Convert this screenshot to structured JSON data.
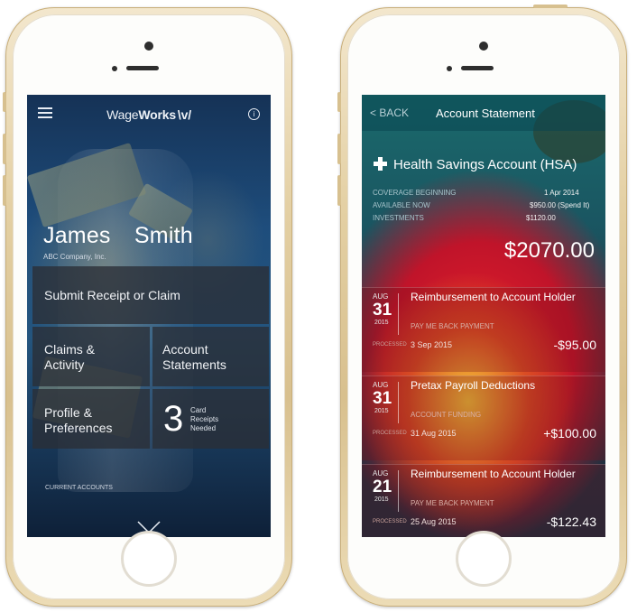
{
  "left_phone": {
    "header": {
      "brand_text": "Wage",
      "brand_bold": "Works",
      "brand_mark": "\\v/",
      "info_icon_glyph": "i"
    },
    "user": {
      "name": "James  Smith",
      "company": "ABC Company, Inc."
    },
    "tiles": {
      "submit": "Submit Receipt or Claim",
      "claims": "Claims &\nActivity",
      "statements": "Account\nStatements",
      "profile": "Profile &\nPreferences",
      "card_count": "3",
      "card_text": "Card\nReceipts\nNeeded"
    },
    "footer": {
      "current_accounts": "CURRENT ACCOUNTS"
    }
  },
  "right_phone": {
    "navbar": {
      "back_label": "< BACK",
      "title": "Account Statement"
    },
    "account": {
      "name": "Health Savings Account (HSA)",
      "coverage_label": "COVERAGE BEGINNING",
      "coverage_value": "1 Apr 2014",
      "available_label": "AVAILABLE NOW",
      "available_value": "$950.00 (Spend It)",
      "investments_label": "INVESTMENTS",
      "investments_value": "$1120.00",
      "balance": "$2070.00"
    },
    "transactions": [
      {
        "month": "AUG",
        "day": "31",
        "year": "2015",
        "description": "Reimbursement to Account Holder",
        "type": "PAY ME BACK PAYMENT",
        "processed_label": "PROCESSED",
        "processed_date": "3 Sep 2015",
        "amount": "-$95.00"
      },
      {
        "month": "AUG",
        "day": "31",
        "year": "2015",
        "description": "Pretax Payroll Deductions",
        "type": "ACCOUNT FUNDING",
        "processed_label": "PROCESSED",
        "processed_date": "31 Aug 2015",
        "amount": "+$100.00"
      },
      {
        "month": "AUG",
        "day": "21",
        "year": "2015",
        "description": "Reimbursement to Account Holder",
        "type": "PAY ME BACK PAYMENT",
        "processed_label": "PROCESSED",
        "processed_date": "25 Aug 2015",
        "amount": "-$122.43"
      }
    ]
  },
  "colors": {
    "phone_gold": "#e3cfa2",
    "left_screen_blue": "#1e4d7c",
    "right_screen_red": "#e8202a",
    "tile_dark": "#2a2e36"
  }
}
